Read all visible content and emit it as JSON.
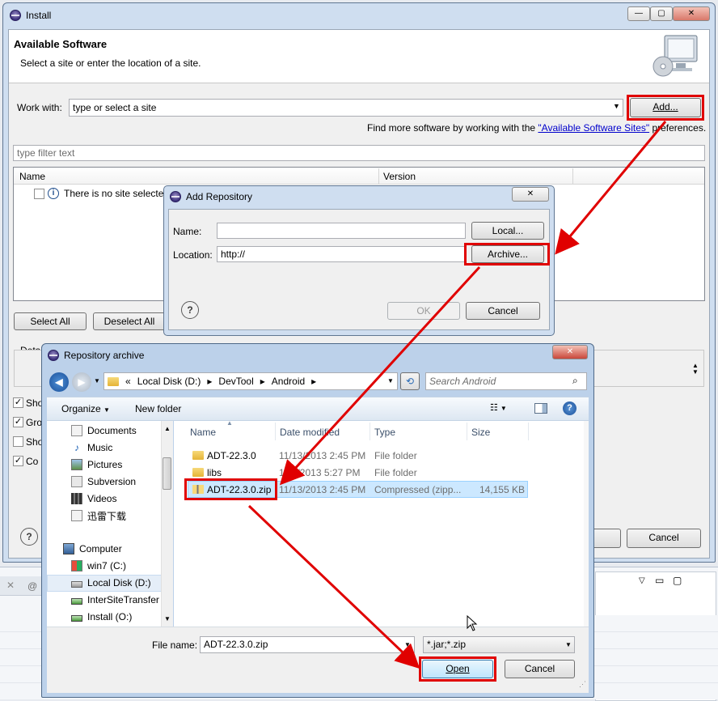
{
  "install": {
    "title": "Install",
    "header_title": "Available Software",
    "header_subtitle": "Select a site or enter the location of a site.",
    "work_with_label": "Work with:",
    "work_with_value": "type or select a site",
    "add_button": "Add...",
    "find_more_prefix": "Find more software by working with the ",
    "find_more_link": "\"Available Software Sites\"",
    "find_more_suffix": " preferences.",
    "filter_placeholder": "type filter text",
    "columns": [
      "Name",
      "Version"
    ],
    "empty_row": "There is no site selected",
    "select_all": "Select All",
    "deselect_all": "Deselect All",
    "details_label": "Deta",
    "checkbox_labels": [
      "Sho",
      "Gro",
      "Sho",
      "Co"
    ],
    "cancel": "Cancel"
  },
  "add_repo": {
    "title": "Add Repository",
    "name_label": "Name:",
    "location_label": "Location:",
    "location_value": "http://",
    "local_button": "Local...",
    "archive_button": "Archive...",
    "ok": "OK",
    "cancel": "Cancel"
  },
  "archive": {
    "title": "Repository archive",
    "breadcrumb_prefix": "«",
    "breadcrumb": [
      "Local Disk (D:)",
      "DevTool",
      "Android"
    ],
    "search_placeholder": "Search Android",
    "organize": "Organize",
    "new_folder": "New folder",
    "nav": [
      "Documents",
      "Music",
      "Pictures",
      "Subversion",
      "Videos",
      "迅雷下载",
      "Computer",
      "win7 (C:)",
      "Local Disk (D:)",
      "InterSiteTransfer",
      "Install (O:)"
    ],
    "columns": [
      "Name",
      "Date modified",
      "Type",
      "Size"
    ],
    "files": [
      {
        "name": "ADT-22.3.0",
        "date": "11/13/2013 2:45 PM",
        "type": "File folder",
        "size": ""
      },
      {
        "name": "libs",
        "date": "11/7/2013 5:27 PM",
        "type": "File folder",
        "size": ""
      },
      {
        "name": "ADT-22.3.0.zip",
        "date": "11/13/2013 2:45 PM",
        "type": "Compressed (zipp...",
        "size": "14,155 KB"
      }
    ],
    "file_name_label": "File name:",
    "file_name_value": "ADT-22.3.0.zip",
    "file_type_value": "*.jar;*.zip",
    "open": "Open",
    "cancel": "Cancel"
  },
  "colors": {
    "annotation": "#e00000",
    "link": "#0000cc",
    "selection": "#cce8ff"
  },
  "background_ide": {
    "tab_fragment": "@"
  }
}
